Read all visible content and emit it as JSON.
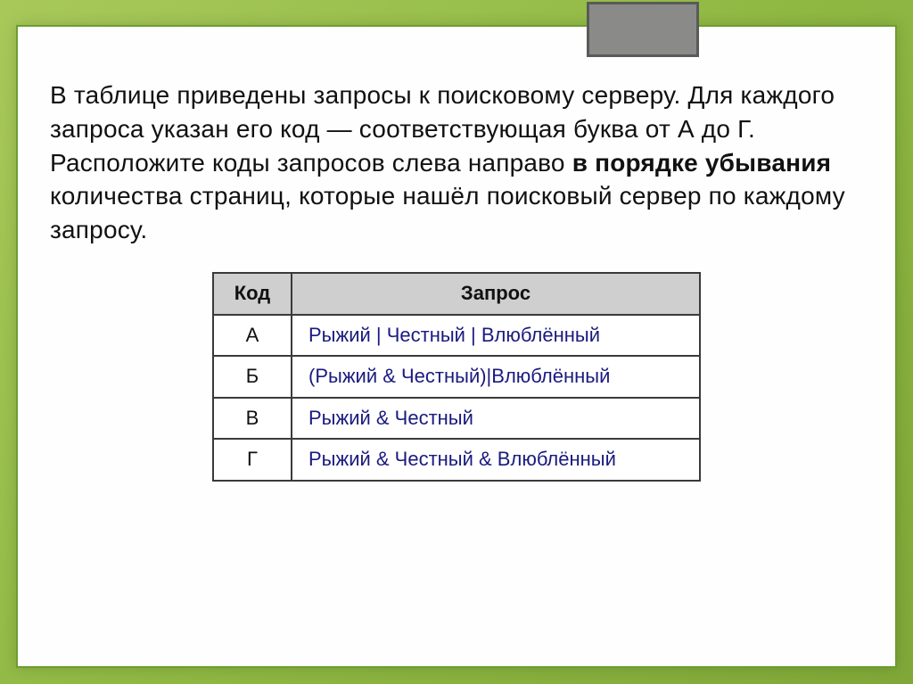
{
  "question": {
    "part1": "В таблице приведены запросы к поисковому серверу. Для каждого запроса указан его код — соответствующая буква от А до Г. Расположите коды запросов слева направо ",
    "bold": "в порядке убывания",
    "part2": " количества страниц, которые нашёл поисковый сервер по каждому запросу."
  },
  "table": {
    "headers": {
      "code": "Код",
      "query": "Запрос"
    },
    "rows": [
      {
        "code": "А",
        "query": "Рыжий | Честный | Влюблённый"
      },
      {
        "code": "Б",
        "query": "(Рыжий & Честный)|Влюблённый"
      },
      {
        "code": "В",
        "query": "Рыжий & Честный"
      },
      {
        "code": "Г",
        "query": "Рыжий & Честный & Влюблённый"
      }
    ]
  }
}
